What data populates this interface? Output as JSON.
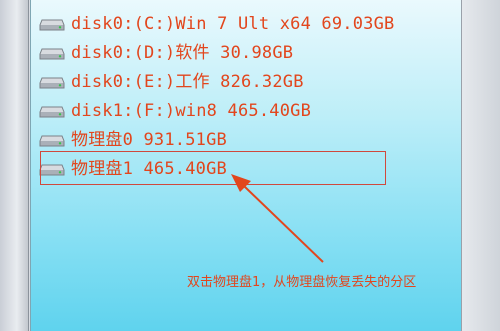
{
  "drive_list": {
    "items": [
      {
        "label": "disk0:(C:)Win 7 Ult x64 69.03GB",
        "icon": "drive-icon"
      },
      {
        "label": "disk0:(D:)软件 30.98GB",
        "icon": "drive-icon"
      },
      {
        "label": "disk0:(E:)工作 826.32GB",
        "icon": "drive-icon"
      },
      {
        "label": "disk1:(F:)win8 465.40GB",
        "icon": "drive-icon"
      },
      {
        "label": "物理盘0 931.51GB",
        "icon": "drive-icon"
      },
      {
        "label": "物理盘1 465.40GB",
        "icon": "drive-icon"
      }
    ]
  },
  "annotation": {
    "text": "双击物理盘1，从物理盘恢复丢失的分区",
    "color": "#e2461d"
  },
  "colors": {
    "label": "#e2461d",
    "highlight_border": "#d0483c",
    "panel_gradient_top": "#eaf9fd",
    "panel_gradient_bottom": "#5fd3ee"
  }
}
